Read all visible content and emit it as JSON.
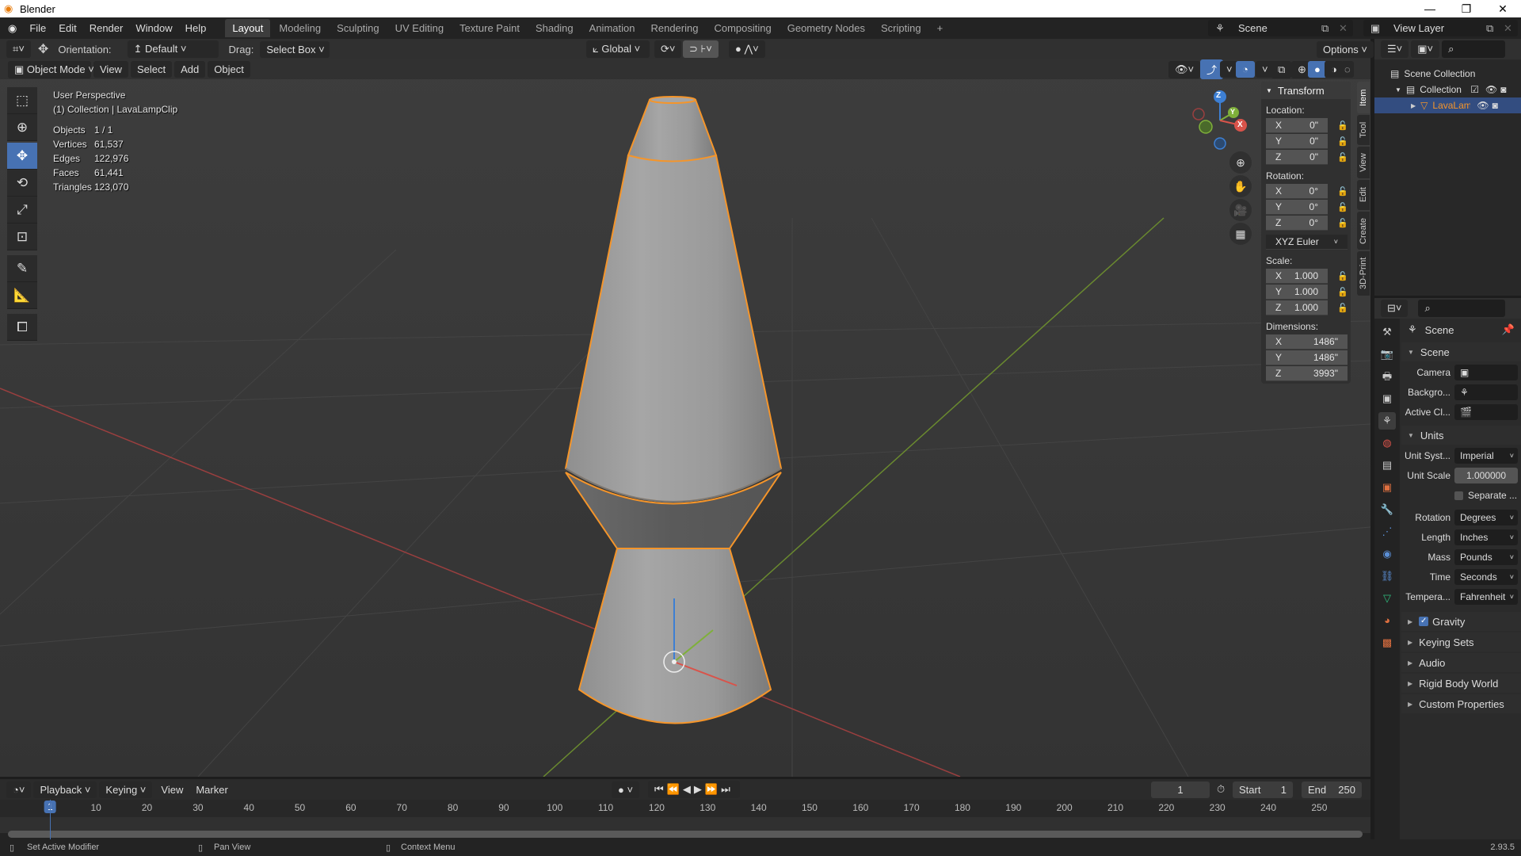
{
  "window": {
    "title": "Blender"
  },
  "menu": [
    "File",
    "Edit",
    "Render",
    "Window",
    "Help"
  ],
  "workspaces": [
    "Layout",
    "Modeling",
    "Sculpting",
    "UV Editing",
    "Texture Paint",
    "Shading",
    "Animation",
    "Rendering",
    "Compositing",
    "Geometry Nodes",
    "Scripting"
  ],
  "workspace_active": "Layout",
  "add_ws": "+",
  "scene": {
    "name": "Scene",
    "view_layer": "View Layer"
  },
  "toolheader": {
    "orientation_label": "Orientation:",
    "orientation": "Default",
    "drag_label": "Drag:",
    "drag": "Select Box",
    "transform": "Global",
    "options": "Options"
  },
  "vpheader": {
    "mode": "Object Mode",
    "items": [
      "View",
      "Select",
      "Add",
      "Object"
    ]
  },
  "overlay": {
    "perspective": "User Perspective",
    "context": "(1) Collection | LavaLampClip",
    "stats": [
      {
        "k": "Objects",
        "v": "1 / 1"
      },
      {
        "k": "Vertices",
        "v": "61,537"
      },
      {
        "k": "Edges",
        "v": "122,976"
      },
      {
        "k": "Faces",
        "v": "61,441"
      },
      {
        "k": "Triangles",
        "v": "123,070"
      }
    ]
  },
  "gizmo": {
    "z": "Z",
    "y": "Y",
    "x": "X"
  },
  "npanel": {
    "title": "Transform",
    "location_label": "Location:",
    "location": [
      [
        "X",
        "0\""
      ],
      [
        "Y",
        "0\""
      ],
      [
        "Z",
        "0\""
      ]
    ],
    "rotation_label": "Rotation:",
    "rotation": [
      [
        "X",
        "0°"
      ],
      [
        "Y",
        "0°"
      ],
      [
        "Z",
        "0°"
      ]
    ],
    "rotation_mode": "XYZ Euler",
    "scale_label": "Scale:",
    "scale": [
      [
        "X",
        "1.000"
      ],
      [
        "Y",
        "1.000"
      ],
      [
        "Z",
        "1.000"
      ]
    ],
    "dimensions_label": "Dimensions:",
    "dimensions": [
      [
        "X",
        "1486\""
      ],
      [
        "Y",
        "1486\""
      ],
      [
        "Z",
        "3993\""
      ]
    ],
    "tabs": [
      "Item",
      "Tool",
      "View",
      "Edit",
      "Create",
      "3D-Print"
    ]
  },
  "outliner": {
    "root": "Scene Collection",
    "collection": "Collection",
    "object": "LavaLampClip"
  },
  "properties": {
    "header": "Scene",
    "scene_section": "Scene",
    "camera_label": "Camera",
    "background_label": "Backgro...",
    "active_clip_label": "Active Cl...",
    "units_section": "Units",
    "unit_system_label": "Unit Syst...",
    "unit_system": "Imperial",
    "unit_scale_label": "Unit Scale",
    "unit_scale": "1.000000",
    "separate_label": "Separate ...",
    "rotation_label": "Rotation",
    "rotation": "Degrees",
    "length_label": "Length",
    "length": "Inches",
    "mass_label": "Mass",
    "mass": "Pounds",
    "time_label": "Time",
    "time": "Seconds",
    "temp_label": "Tempera...",
    "temp": "Fahrenheit",
    "gravity": "Gravity",
    "sections": [
      "Keying Sets",
      "Audio",
      "Rigid Body World",
      "Custom Properties"
    ]
  },
  "timeline": {
    "menus": [
      "Playback",
      "Keying",
      "View",
      "Marker"
    ],
    "current": "1",
    "start_label": "Start",
    "start": "1",
    "end_label": "End",
    "end": "250",
    "ticks": [
      "1",
      "10",
      "20",
      "30",
      "40",
      "50",
      "60",
      "70",
      "80",
      "90",
      "100",
      "110",
      "120",
      "130",
      "140",
      "150",
      "160",
      "170",
      "180",
      "190",
      "200",
      "210",
      "220",
      "230",
      "240",
      "250"
    ]
  },
  "status": {
    "left": "Set Active Modifier",
    "mid": "Pan View",
    "right": "Context Menu",
    "version": "2.93.5"
  },
  "colors": {
    "accent": "#4772b3",
    "selection": "#f5952a",
    "x_axis": "#d9534a",
    "y_axis": "#7fb03a",
    "z_axis": "#3d7fd3"
  }
}
